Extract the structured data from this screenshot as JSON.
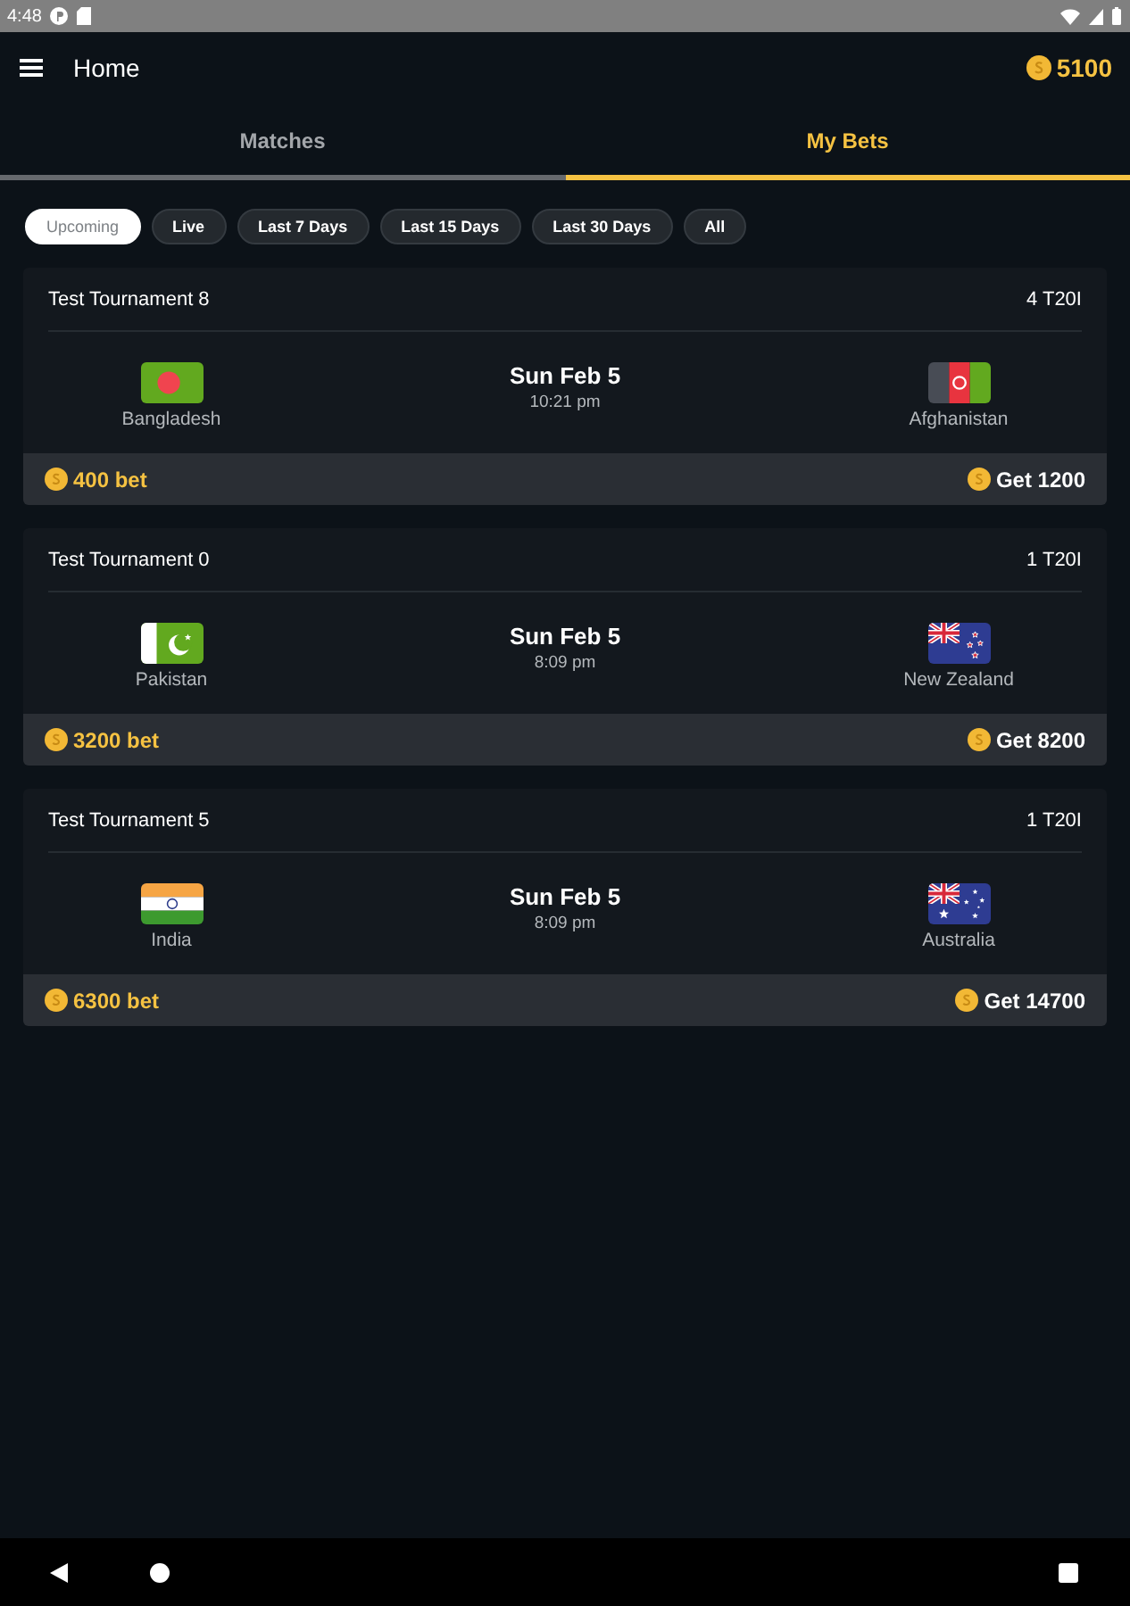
{
  "status_bar": {
    "time": "4:48"
  },
  "app_bar": {
    "title": "Home",
    "balance": "5100"
  },
  "tabs": [
    {
      "label": "Matches",
      "selected": false
    },
    {
      "label": "My Bets",
      "selected": true
    }
  ],
  "filters": [
    {
      "label": "Upcoming",
      "selected": true
    },
    {
      "label": "Live",
      "selected": false
    },
    {
      "label": "Last 7 Days",
      "selected": false
    },
    {
      "label": "Last 15 Days",
      "selected": false
    },
    {
      "label": "Last 30 Days",
      "selected": false
    },
    {
      "label": "All",
      "selected": false
    }
  ],
  "bets": [
    {
      "tournament": "Test Tournament 8",
      "match_no": "4 T20I",
      "team_1": {
        "name": "Bangladesh",
        "kind": "bangladesh"
      },
      "team_2": {
        "name": "Afghanistan",
        "kind": "afghanistan"
      },
      "date": "Sun Feb 5",
      "time": "10:21 pm",
      "stake": "400 bet",
      "payout": "Get 1200"
    },
    {
      "tournament": "Test Tournament 0",
      "match_no": "1 T20I",
      "team_1": {
        "name": "Pakistan",
        "kind": "pakistan"
      },
      "team_2": {
        "name": "New Zealand",
        "kind": "newzealand"
      },
      "date": "Sun Feb 5",
      "time": "8:09 pm",
      "stake": "3200 bet",
      "payout": "Get 8200"
    },
    {
      "tournament": "Test Tournament 5",
      "match_no": "1 T20I",
      "team_1": {
        "name": "India",
        "kind": "india"
      },
      "team_2": {
        "name": "Australia",
        "kind": "australia"
      },
      "date": "Sun Feb 5",
      "time": "8:09 pm",
      "stake": "6300 bet",
      "payout": "Get 14700"
    }
  ]
}
